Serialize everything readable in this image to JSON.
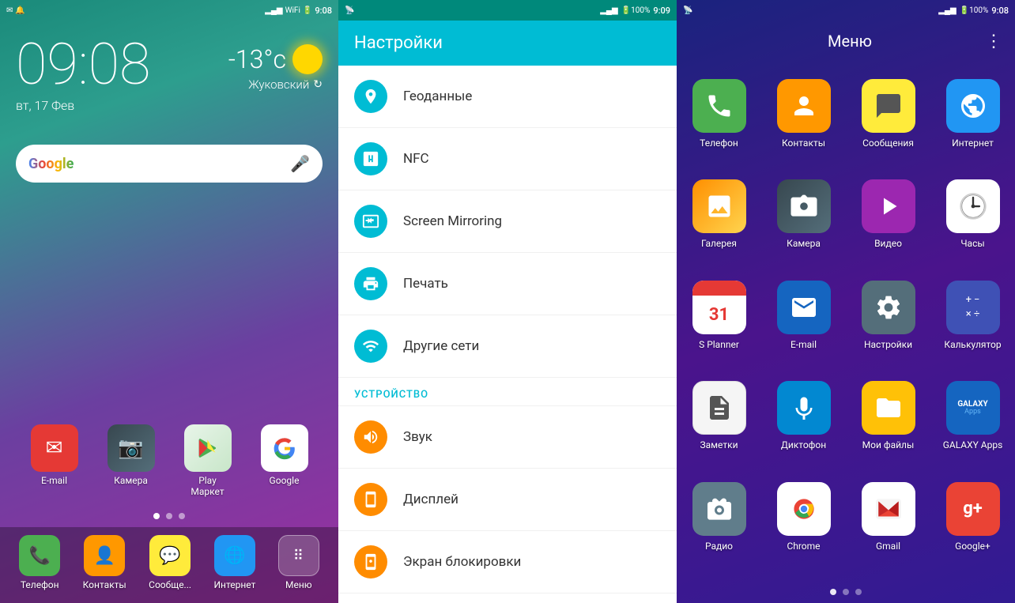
{
  "panel1": {
    "statusbar": {
      "icons_left": [
        "notification1",
        "notification2"
      ],
      "signal": "▂▄▆█",
      "battery": "100%",
      "time": "9:08"
    },
    "clock": {
      "time": "09:08",
      "date": "вт, 17 Фев"
    },
    "weather": {
      "temp": "-13°с",
      "city": "Жуковский"
    },
    "search": {
      "placeholder": "Google",
      "mic_label": "🎤"
    },
    "dock_apps": [
      {
        "name": "email",
        "label": "E-mail",
        "bg": "bg-email",
        "icon": "✉"
      },
      {
        "name": "camera",
        "label": "Камера",
        "bg": "bg-camera",
        "icon": "📷"
      },
      {
        "name": "playmarket",
        "label": "Play\nМаркет",
        "bg": "bg-playstore",
        "icon": "▶"
      },
      {
        "name": "google",
        "label": "Google",
        "bg": "bg-google",
        "icon": "G"
      }
    ],
    "bottom_apps": [
      {
        "name": "phone",
        "label": "Телефон",
        "bg": "bg-phone",
        "icon": "📞"
      },
      {
        "name": "contacts",
        "label": "Контакты",
        "bg": "bg-contacts",
        "icon": "👤"
      },
      {
        "name": "messages",
        "label": "Сообще...",
        "bg": "bg-messages",
        "icon": "💬"
      },
      {
        "name": "internet",
        "label": "Интернет",
        "bg": "bg-internet",
        "icon": "🌐"
      },
      {
        "name": "menu",
        "label": "Меню",
        "bg": "bg-menu",
        "icon": "⋮⋮⋮"
      }
    ],
    "nav_dots": [
      true,
      false,
      false
    ]
  },
  "panel2": {
    "statusbar": {
      "time": "9:09"
    },
    "header": {
      "title": "Настройки"
    },
    "items": [
      {
        "id": "geodata",
        "icon": "📍",
        "label": "Геоданные",
        "type": "teal"
      },
      {
        "id": "nfc",
        "icon": "⬡",
        "label": "NFC",
        "type": "teal"
      },
      {
        "id": "mirroring",
        "icon": "▣",
        "label": "Screen Mirroring",
        "type": "teal"
      },
      {
        "id": "print",
        "icon": "🖨",
        "label": "Печать",
        "type": "teal"
      },
      {
        "id": "networks",
        "icon": "⊙",
        "label": "Другие сети",
        "type": "teal"
      }
    ],
    "section_device": "УСТРОЙСТВО",
    "device_items": [
      {
        "id": "sound",
        "icon": "🔊",
        "label": "Звук",
        "type": "orange"
      },
      {
        "id": "display",
        "icon": "📱",
        "label": "Дисплей",
        "type": "orange"
      },
      {
        "id": "lockscreen",
        "icon": "🔒",
        "label": "Экран блокировки",
        "type": "orange"
      }
    ]
  },
  "panel3": {
    "statusbar": {
      "time": "9:08"
    },
    "header": {
      "title": "Меню",
      "menu_icon": "⋮"
    },
    "apps": [
      {
        "name": "telefon",
        "label": "Телефон",
        "bg": "bg-telefon",
        "icon": "📞"
      },
      {
        "name": "contacts",
        "label": "Контакты",
        "bg": "bg-kontakty",
        "icon": "👤"
      },
      {
        "name": "messages",
        "label": "Сообщения",
        "bg": "bg-soobsh",
        "icon": "✉"
      },
      {
        "name": "internet",
        "label": "Интернет",
        "bg": "bg-internet2",
        "icon": "🌐"
      },
      {
        "name": "gallery",
        "label": "Галерея",
        "bg": "bg-galereya",
        "icon": "🍂"
      },
      {
        "name": "camera",
        "label": "Камера",
        "bg": "bg-kamera",
        "icon": "📷"
      },
      {
        "name": "video",
        "label": "Видео",
        "bg": "bg-video",
        "icon": "▶"
      },
      {
        "name": "clock",
        "label": "Часы",
        "bg": "bg-chasy",
        "icon": "🕐"
      },
      {
        "name": "splanner",
        "label": "S Planner",
        "bg": "bg-splanner",
        "icon": "31"
      },
      {
        "name": "email",
        "label": "E-mail",
        "bg": "bg-email2",
        "icon": "@"
      },
      {
        "name": "settings",
        "label": "Настройки",
        "bg": "bg-nastroyki",
        "icon": "⚙"
      },
      {
        "name": "calculator",
        "label": "Калькулятор",
        "bg": "bg-kalkul",
        "icon": "±÷"
      },
      {
        "name": "notes",
        "label": "Заметки",
        "bg": "bg-zametki",
        "icon": "📋"
      },
      {
        "name": "dictaphone",
        "label": "Диктофон",
        "bg": "bg-diktofon",
        "icon": "🎙"
      },
      {
        "name": "myfiles",
        "label": "Мои файлы",
        "bg": "bg-moifayly",
        "icon": "📁"
      },
      {
        "name": "galaxyapps",
        "label": "GALAXY Apps",
        "bg": "bg-galaxyapps",
        "icon": "G"
      },
      {
        "name": "radio",
        "label": "Радио",
        "bg": "bg-radio",
        "icon": "📻"
      },
      {
        "name": "chrome",
        "label": "Chrome",
        "bg": "bg-chrome",
        "icon": "chrome"
      },
      {
        "name": "gmail",
        "label": "Gmail",
        "bg": "bg-gmail",
        "icon": "M"
      },
      {
        "name": "googleplus",
        "label": "Google+",
        "bg": "bg-googleplus",
        "icon": "g+"
      }
    ],
    "page_dots": [
      true,
      false,
      false
    ]
  }
}
